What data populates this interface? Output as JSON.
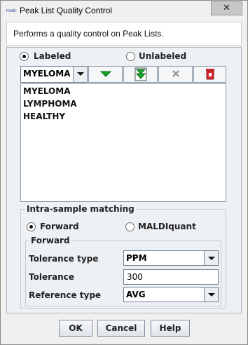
{
  "window": {
    "title": "Peak List Quality Control",
    "icon": "app-icon",
    "icon_text": "msdc",
    "close_glyph": "✕"
  },
  "description": "Performs a quality control on Peak Lists.",
  "mode": {
    "labeled_label": "Labeled",
    "unlabeled_label": "Unlabeled",
    "selected": "Labeled"
  },
  "labels_combo": {
    "value": "MYELOMA"
  },
  "toolbar": {
    "icons": [
      "add-down-arrow-icon",
      "add-all-arrow-icon",
      "remove-x-icon",
      "delete-trash-icon"
    ],
    "colors": {
      "arrow_green": "#13a52b",
      "trash_red": "#d7262c"
    }
  },
  "labels_list": [
    "MYELOMA",
    "LYMPHOMA",
    "HEALTHY"
  ],
  "intra_sample": {
    "title": "Intra-sample matching",
    "forward_label": "Forward",
    "maldiquant_label": "MALDIquant",
    "selected": "Forward",
    "forward_section": {
      "title": "Forward",
      "tolerance_type_label": "Tolerance type",
      "tolerance_type_value": "PPM",
      "tolerance_label": "Tolerance",
      "tolerance_value": "300",
      "reference_type_label": "Reference type",
      "reference_type_value": "AVG"
    }
  },
  "buttons": {
    "ok": "OK",
    "cancel": "Cancel",
    "help": "Help"
  }
}
